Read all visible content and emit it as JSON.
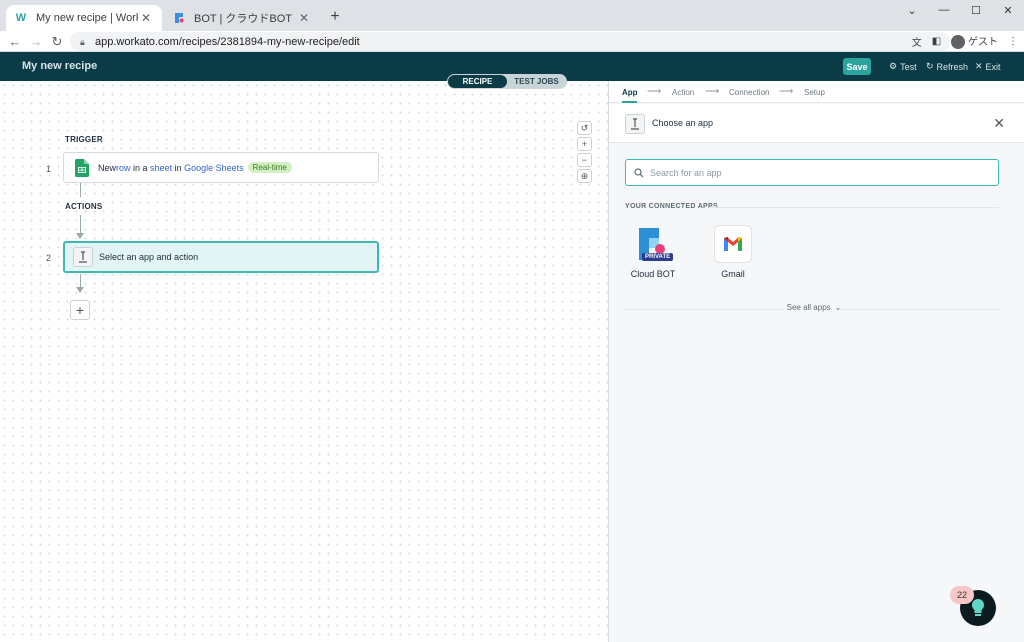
{
  "browser": {
    "tabs": [
      {
        "title": "My new recipe | Workato",
        "favicon": "workato-logo-icon",
        "active": true
      },
      {
        "title": "BOT | クラウドBOT",
        "favicon": "cloudbot-logo-icon",
        "active": false
      }
    ],
    "url": "app.workato.com/recipes/2381894-my-new-recipe/edit",
    "profile_label": "ゲスト"
  },
  "header": {
    "recipe_name": "My new recipe",
    "save_label": "Save",
    "test_label": "Test",
    "refresh_label": "Refresh",
    "exit_label": "Exit"
  },
  "toggle": {
    "recipe_label": "RECIPE",
    "test_jobs_label": "TEST JOBS"
  },
  "canvas": {
    "trigger_label": "TRIGGER",
    "actions_label": "ACTIONS",
    "step1": {
      "number": "1",
      "text_new": "New ",
      "text_row": "row",
      "text_in_a": " in a ",
      "text_sheet": "sheet",
      "text_in": " in ",
      "text_app": "Google Sheets",
      "badge": "Real-time"
    },
    "step2": {
      "number": "2",
      "text": "Select an app and action"
    }
  },
  "panel": {
    "wizard_steps": [
      "App",
      "Action",
      "Connection",
      "Setup"
    ],
    "title": "Choose an app",
    "search_placeholder": "Search for an app",
    "connected_label": "YOUR CONNECTED APPS",
    "apps": [
      {
        "name": "Cloud BOT",
        "badge": "PRIVATE"
      },
      {
        "name": "Gmail"
      }
    ],
    "see_all_label": "See all apps"
  },
  "help": {
    "badge_count": "22"
  },
  "colors": {
    "header_bg": "#0b3b46",
    "accent": "#2ba4a0",
    "selected_bg": "#e2f5f4"
  }
}
